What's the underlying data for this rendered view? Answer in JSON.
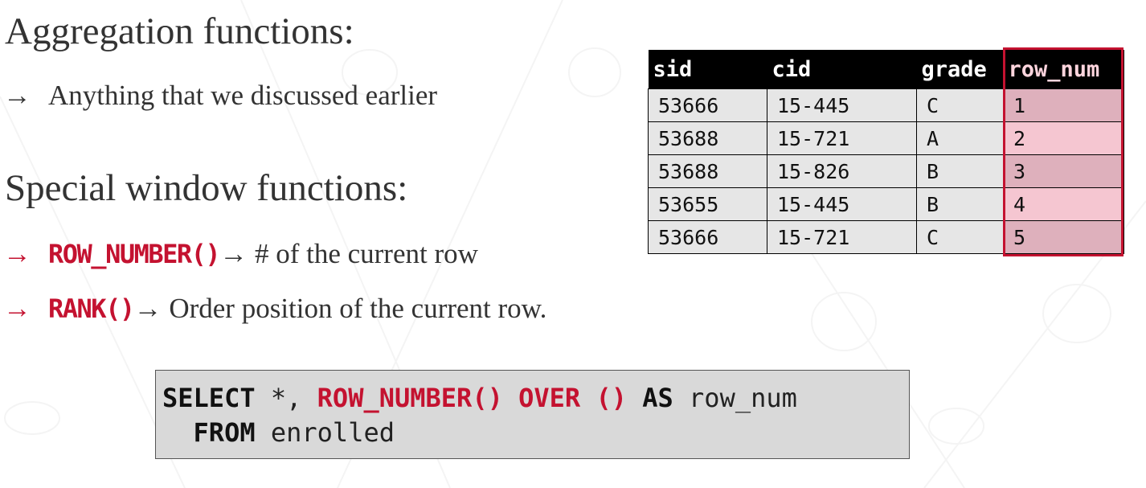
{
  "headings": {
    "aggregation": "Aggregation functions:",
    "special": "Special window functions:"
  },
  "bullets": {
    "arrow": "→",
    "agg_item": "Anything that we discussed earlier",
    "row_number_kw": "ROW_NUMBER()",
    "row_number_desc": "# of the current row",
    "rank_kw": "RANK()",
    "rank_desc": "Order position of the current row."
  },
  "result_table": {
    "columns": [
      "sid",
      "cid",
      "grade",
      "row_num"
    ],
    "rows": [
      [
        "53666",
        "15-445",
        "C",
        "1"
      ],
      [
        "53688",
        "15-721",
        "A",
        "2"
      ],
      [
        "53688",
        "15-826",
        "B",
        "3"
      ],
      [
        "53655",
        "15-445",
        "B",
        "4"
      ],
      [
        "53666",
        "15-721",
        "C",
        "5"
      ]
    ]
  },
  "sql": {
    "select_kw": "SELECT",
    "star": " *, ",
    "fn": "ROW_NUMBER() OVER ()",
    "as_kw": "AS",
    "alias": " row_num",
    "indent": "  ",
    "from_kw": "FROM",
    "table": " enrolled"
  },
  "colors": {
    "accent": "#c41230",
    "text": "#333333",
    "highlight_row_a": "#deb0bc",
    "highlight_row_b": "#f5c6d1",
    "code_bg": "#d9d9d9"
  }
}
